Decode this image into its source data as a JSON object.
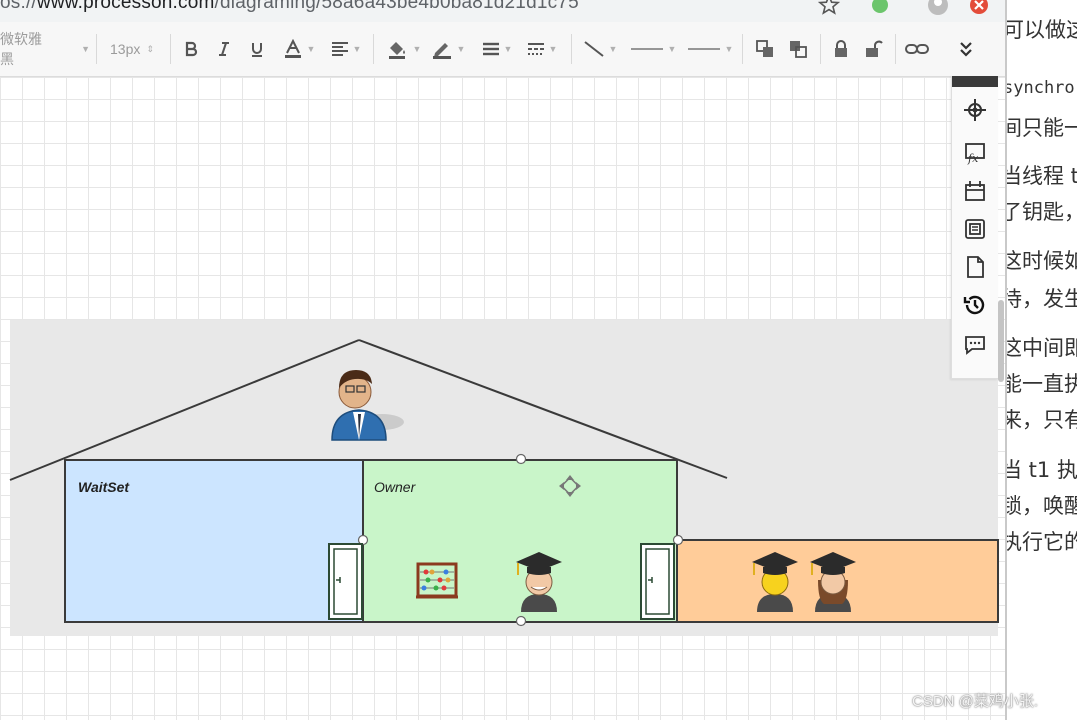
{
  "browser": {
    "url_scheme_fragment": "os://",
    "url_host": "www.processon.com",
    "url_path": "/diagraming/58a6a43be4b0ba81d21d1c75"
  },
  "toolbar": {
    "font_family": "微软雅黑",
    "font_size": "13px"
  },
  "diagram": {
    "labels": {
      "waitset": "WaitSet",
      "owner": "Owner"
    },
    "colors": {
      "waitset_fill": "#cce5ff",
      "owner_fill": "#c9f5c9",
      "entry_fill": "#ffcc99",
      "background_band": "#e8e8e8",
      "door_stroke": "#2c4a34"
    }
  },
  "doc_panel": {
    "lines": [
      "可以做这",
      "synchro",
      "间只能一",
      "当线程 t",
      "了钥匙，",
      "这时候如",
      "待，发生",
      "这中间即",
      "能一直执",
      "来，只有",
      "当 t1 执",
      "锁，唤醒",
      "执行它的"
    ]
  },
  "watermark": "CSDN @菜鸡小张."
}
